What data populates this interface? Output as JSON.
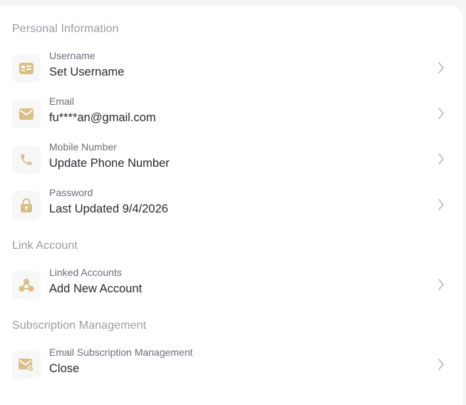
{
  "colors": {
    "accent": "#d9bf87",
    "section_title": "#9b9ba3",
    "label": "#6e6e76",
    "value": "#2a2a2e",
    "chevron": "#b4b4ba"
  },
  "sections": [
    {
      "title": "Personal Information",
      "items": [
        {
          "icon": "id-card-icon",
          "label": "Username",
          "value": "Set Username"
        },
        {
          "icon": "mail-icon",
          "label": "Email",
          "value": "fu****an@gmail.com"
        },
        {
          "icon": "phone-icon",
          "label": "Mobile Number",
          "value": "Update Phone Number"
        },
        {
          "icon": "lock-icon",
          "label": "Password",
          "value": "Last Updated 9/4/2026"
        }
      ]
    },
    {
      "title": "Link Account",
      "items": [
        {
          "icon": "network-nodes-icon",
          "label": "Linked Accounts",
          "value": "Add New Account"
        }
      ]
    },
    {
      "title": "Subscription Management",
      "items": [
        {
          "icon": "mail-settings-icon",
          "label": "Email Subscription Management",
          "value": "Close"
        }
      ]
    }
  ]
}
